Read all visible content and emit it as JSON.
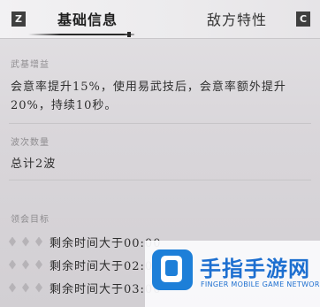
{
  "tabs": {
    "left_key": "Z",
    "right_key": "C",
    "items": [
      {
        "label": "基础信息",
        "active": true
      },
      {
        "label": "敌方特性",
        "active": false
      }
    ]
  },
  "martial_buff": {
    "title": "武基增益",
    "text": "会意率提升15%，使用易武技后，会意率额外提升20%，持续10秒。"
  },
  "waves": {
    "title": "波次数量",
    "text": "总计2波"
  },
  "goals": {
    "title": "领会目标",
    "items": [
      {
        "text": "剩余时间大于00:00",
        "stars": 3
      },
      {
        "text": "剩余时间大于02:00",
        "stars": 3
      },
      {
        "text": "剩余时间大于03:00",
        "stars": 3
      }
    ]
  },
  "watermark": {
    "title": "手指手游网",
    "subtitle": "FINGER MOBILE GAME NETWORK"
  },
  "colors": {
    "background": "#dcd9dd",
    "key_badge": "#3f3f3f",
    "diamond": "#b6b3b7",
    "watermark_blue": "#1d6fd0"
  }
}
